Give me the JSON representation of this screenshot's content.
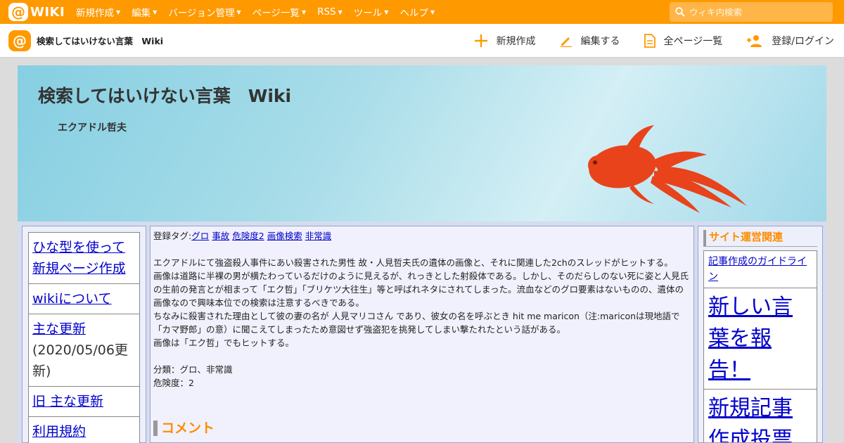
{
  "topbar": {
    "brand": "WIKI",
    "brand_mark": "@",
    "nav": [
      "新規作成",
      "編集",
      "バージョン管理",
      "ページ一覧",
      "RSS",
      "ツール",
      "ヘルプ"
    ],
    "search_placeholder": "ウィキ内検索",
    "bg_color": "#ff9900"
  },
  "subbar": {
    "logo_mark": "@",
    "site_title": "検索してはいけない言葉　Wiki",
    "actions": [
      {
        "label": "新規作成",
        "icon": "plus-icon"
      },
      {
        "label": "編集する",
        "icon": "pencil-icon"
      },
      {
        "label": "全ページ一覧",
        "icon": "document-icon"
      },
      {
        "label": "登録/ログイン",
        "icon": "add-user-icon"
      }
    ]
  },
  "banner": {
    "title": "検索してはいけない言葉　Wiki",
    "subtitle": "エクアドル哲夫",
    "image": "goldfish"
  },
  "left_menu": {
    "items": [
      {
        "label": "ひな型を使って新規ページ作成",
        "suffix": ""
      },
      {
        "label": "wikiについて",
        "suffix": ""
      },
      {
        "label": "主な更新",
        "suffix": "(2020/05/06更新)"
      },
      {
        "label": "旧 主な更新",
        "suffix": ""
      },
      {
        "label": "利用規約",
        "suffix": ""
      }
    ]
  },
  "main": {
    "tags_label": "登録タグ:",
    "tags": [
      "グロ",
      "事故",
      "危険度2",
      "画像検索",
      "非常識"
    ],
    "paragraphs": [
      "エクアドルにて強盗殺人事件にあい殺害された男性 故・人見哲夫氏の遺体の画像と、それに関連した2chのスレッドがヒットする。",
      "画像は道路に半裸の男が横たわっているだけのように見えるが、れっきとした射殺体である。しかし、そのだらしのない死に姿と人見氏の生前の発言とが相まって「エク哲」「ブリケツ大往生」等と呼ばれネタにされてしまった。流血などのグロ要素はないものの、遺体の画像なので興味本位での検索は注意するべきである。",
      "ちなみに殺害された理由として彼の妻の名が 人見マリコさん であり、彼女の名を呼ぶとき hit me maricon（注:mariconは現地語で「カマ野郎」の意）に聞こえてしまったため意図せず強盗犯を挑発してしまい撃たれたという話がある。",
      "画像は「エク哲」でもヒットする。"
    ],
    "category": "分類：グロ、非常識",
    "danger": "危険度：2",
    "comment_heading": "コメント"
  },
  "right_menu": {
    "heading": "サイト運営関連",
    "items": [
      {
        "label": "記事作成のガイドライン",
        "size": "small"
      },
      {
        "label": "新しい言葉を報告！",
        "size": "big"
      },
      {
        "label": "新規記事作成投票",
        "size": "big"
      }
    ]
  }
}
